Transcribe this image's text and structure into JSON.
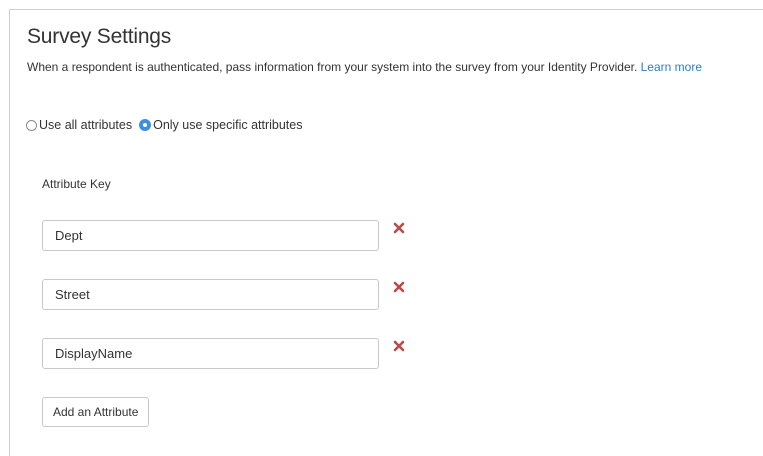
{
  "title": "Survey Settings",
  "description": {
    "text": "When a respondent is authenticated, pass information from your system into the survey from your Identity Provider. ",
    "link_text": "Learn more"
  },
  "attribute_mode": {
    "options": [
      {
        "label": "Use all attributes",
        "checked": false
      },
      {
        "label": "Only use specific attributes",
        "checked": true
      }
    ]
  },
  "attributes": {
    "label": "Attribute Key",
    "items": [
      {
        "value": "Dept"
      },
      {
        "value": "Street"
      },
      {
        "value": "DisplayName"
      }
    ],
    "remove_icon": "remove-x-icon",
    "remove_color": "#b94a48"
  },
  "add_button_label": "Add an Attribute",
  "colors": {
    "link": "#2b7fc7",
    "radio_selected": "#3d8fe6"
  }
}
